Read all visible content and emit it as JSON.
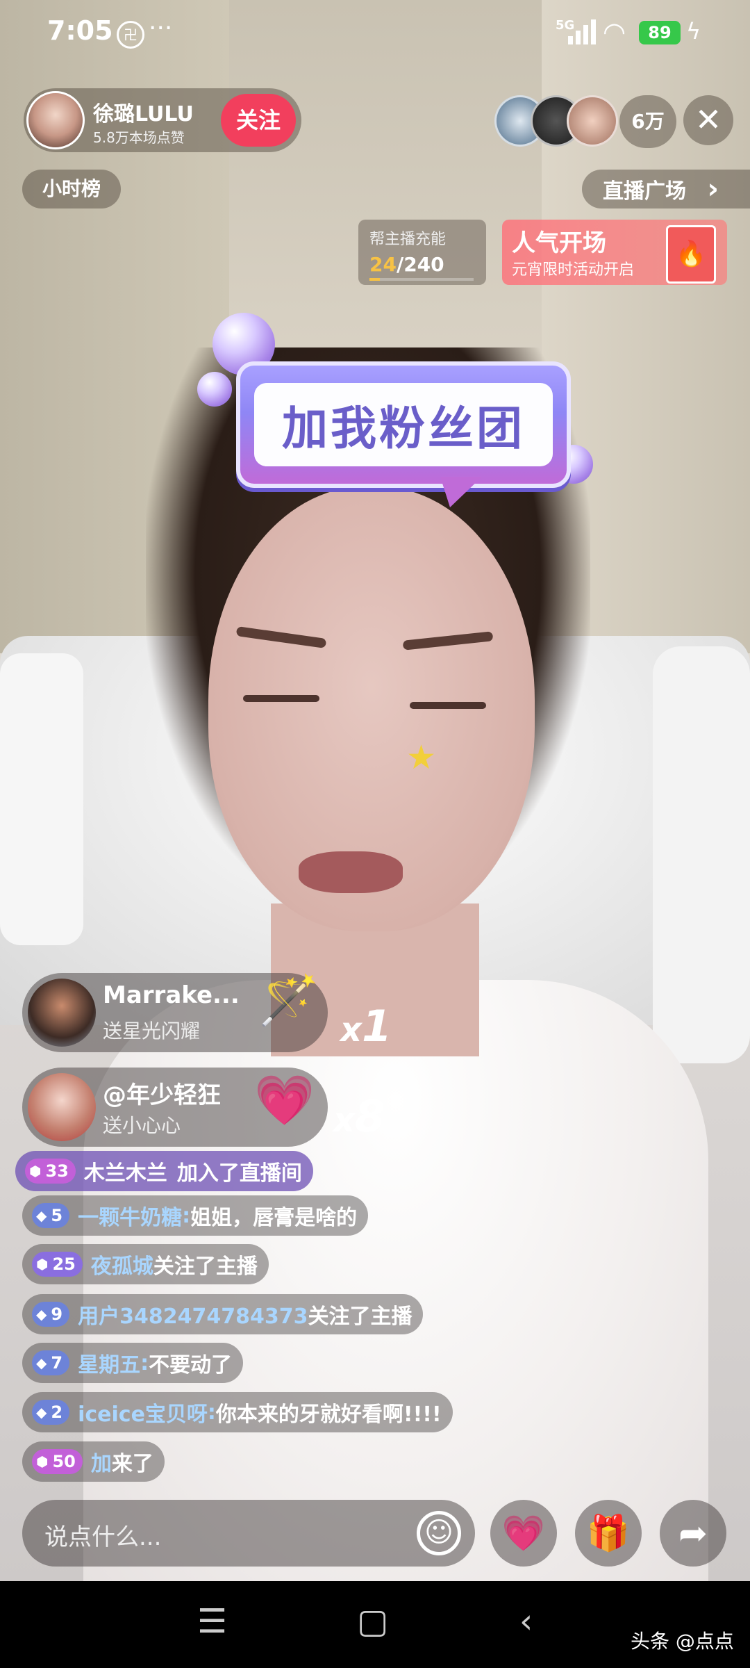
{
  "status_bar": {
    "time": "7:05",
    "app_badge": "卍",
    "dots": "···",
    "network": "5G",
    "wifi_glyph": "◠",
    "battery": "89",
    "charging_glyph": "ϟ"
  },
  "host": {
    "name": "徐璐LULU",
    "likes": "5.8万本场点赞",
    "follow_label": "关注"
  },
  "viewers": {
    "count": "6万",
    "close_glyph": "✕"
  },
  "rank": {
    "hour_rank_label": "小时榜",
    "plaza_label": "直播广场",
    "plaza_arrow": "›"
  },
  "charge": {
    "title": "帮主播充能",
    "current": "24",
    "total": "/240",
    "progress_fraction": 0.1
  },
  "popularity": {
    "title": "人气开场",
    "subtitle": "元宵限时活动开启",
    "icon": "🔥"
  },
  "sticker": {
    "text": "加我粉丝团"
  },
  "gifts": [
    {
      "user": "Marrake...",
      "desc": "送星光闪耀",
      "icon": "🪄",
      "times": "x",
      "count": "1"
    },
    {
      "user": "@年少轻狂",
      "desc": "送小心心",
      "icon": "💗",
      "times": "x",
      "count": "8"
    }
  ],
  "join_message": {
    "level": "33",
    "user": "木兰木兰",
    "text": "加入了直播间"
  },
  "comments": [
    {
      "level": "5",
      "badge": "blue",
      "user": "一颗牛奶糖",
      "text": "姐姐，唇膏是啥的"
    },
    {
      "level": "25",
      "badge": "purple",
      "user": "夜孤城",
      "text": "关注了主播"
    },
    {
      "level": "9",
      "badge": "blue",
      "user": "用户3482474784373",
      "text": "关注了主播"
    },
    {
      "level": "7",
      "badge": "blue",
      "user": "星期五",
      "text": "不要动了"
    },
    {
      "level": "2",
      "badge": "blue",
      "user": "iceice宝贝呀",
      "text": "你本来的牙就好看啊!!!!"
    },
    {
      "level": "50",
      "badge": "pink",
      "user": "加",
      "text": "来了"
    }
  ],
  "input": {
    "placeholder": "说点什么..."
  },
  "actions": {
    "emoji": "☺",
    "heart": "💗",
    "gift": "🎁",
    "share": "➦"
  },
  "nav": {
    "menu": "☰",
    "home": "▢",
    "back": "‹"
  },
  "watermark": "头条 @点点",
  "colors": {
    "follow": "#f23f5d",
    "battery": "#36c84a",
    "charge_accent": "#f7c245",
    "username": "#a9d6ff"
  }
}
